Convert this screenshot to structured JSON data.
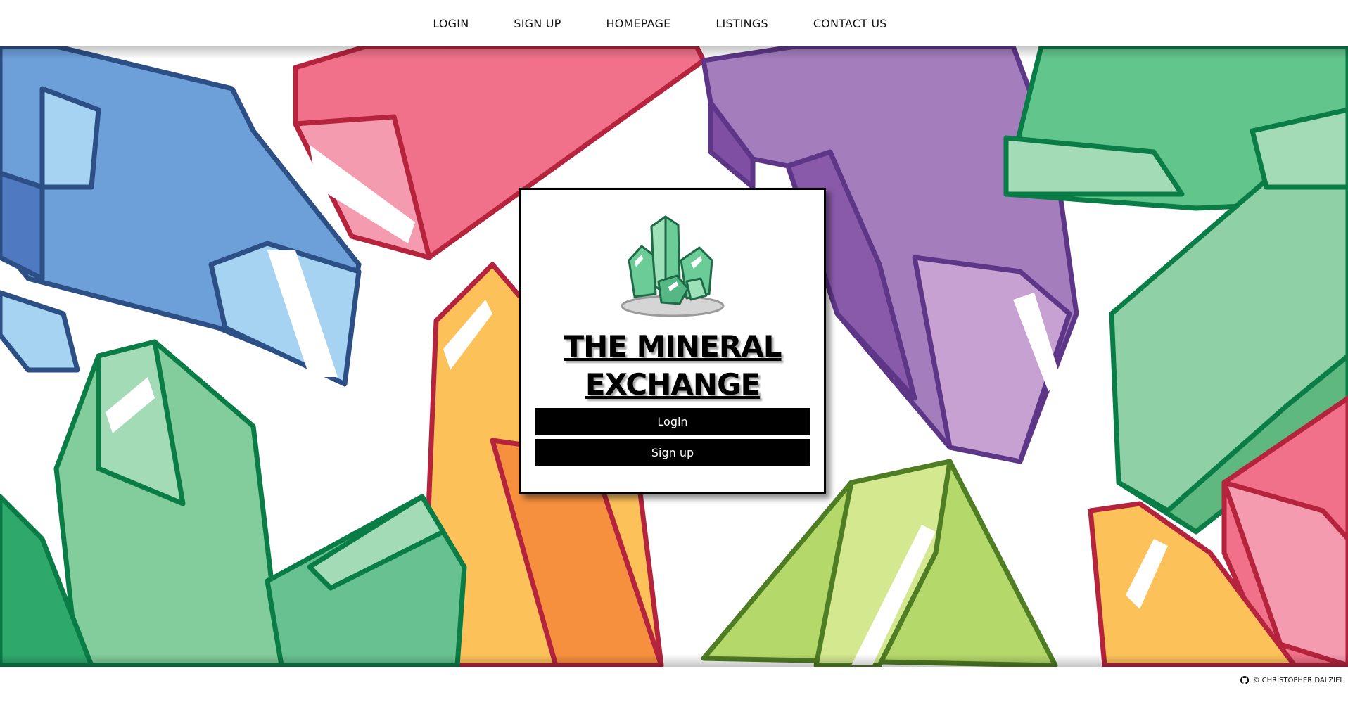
{
  "nav": {
    "items": [
      {
        "label": "LOGIN"
      },
      {
        "label": "SIGN UP"
      },
      {
        "label": "HOMEPAGE"
      },
      {
        "label": "LISTINGS"
      },
      {
        "label": "CONTACT US"
      }
    ]
  },
  "hero": {
    "background_icon": "crystal-pattern",
    "logo_icon": "green-crystal-cluster-icon"
  },
  "card": {
    "title_line1": "THE MINERAL",
    "title_line2": "EXCHANGE",
    "login_label": "Login",
    "signup_label": "Sign up"
  },
  "footer": {
    "credit": "© CHRISTOPHER DALZIEL",
    "icon": "github-icon"
  },
  "colors": {
    "nav_bg": "#ffffff",
    "button_bg": "#000000",
    "button_text": "#ffffff",
    "blue": "#6d9fd8",
    "pink": "#f07189",
    "purple": "#a47dbd",
    "green": "#6cc48d",
    "yellow": "#fdc15a",
    "lime": "#b5d86a"
  }
}
